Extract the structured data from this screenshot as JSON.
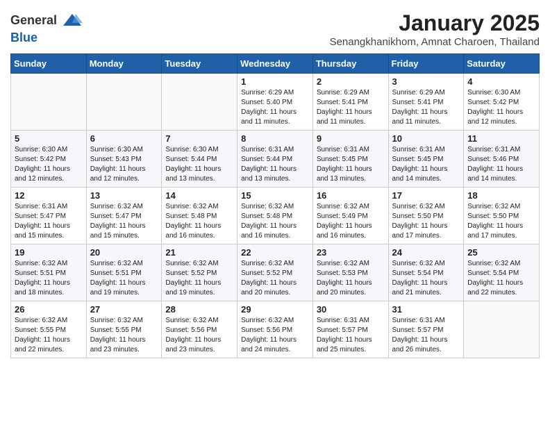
{
  "logo": {
    "general": "General",
    "blue": "Blue"
  },
  "title": "January 2025",
  "subtitle": "Senangkhanikhom, Amnat Charoen, Thailand",
  "headers": [
    "Sunday",
    "Monday",
    "Tuesday",
    "Wednesday",
    "Thursday",
    "Friday",
    "Saturday"
  ],
  "weeks": [
    [
      {
        "day": "",
        "info": ""
      },
      {
        "day": "",
        "info": ""
      },
      {
        "day": "",
        "info": ""
      },
      {
        "day": "1",
        "info": "Sunrise: 6:29 AM\nSunset: 5:40 PM\nDaylight: 11 hours\nand 11 minutes."
      },
      {
        "day": "2",
        "info": "Sunrise: 6:29 AM\nSunset: 5:41 PM\nDaylight: 11 hours\nand 11 minutes."
      },
      {
        "day": "3",
        "info": "Sunrise: 6:29 AM\nSunset: 5:41 PM\nDaylight: 11 hours\nand 11 minutes."
      },
      {
        "day": "4",
        "info": "Sunrise: 6:30 AM\nSunset: 5:42 PM\nDaylight: 11 hours\nand 12 minutes."
      }
    ],
    [
      {
        "day": "5",
        "info": "Sunrise: 6:30 AM\nSunset: 5:42 PM\nDaylight: 11 hours\nand 12 minutes."
      },
      {
        "day": "6",
        "info": "Sunrise: 6:30 AM\nSunset: 5:43 PM\nDaylight: 11 hours\nand 12 minutes."
      },
      {
        "day": "7",
        "info": "Sunrise: 6:30 AM\nSunset: 5:44 PM\nDaylight: 11 hours\nand 13 minutes."
      },
      {
        "day": "8",
        "info": "Sunrise: 6:31 AM\nSunset: 5:44 PM\nDaylight: 11 hours\nand 13 minutes."
      },
      {
        "day": "9",
        "info": "Sunrise: 6:31 AM\nSunset: 5:45 PM\nDaylight: 11 hours\nand 13 minutes."
      },
      {
        "day": "10",
        "info": "Sunrise: 6:31 AM\nSunset: 5:45 PM\nDaylight: 11 hours\nand 14 minutes."
      },
      {
        "day": "11",
        "info": "Sunrise: 6:31 AM\nSunset: 5:46 PM\nDaylight: 11 hours\nand 14 minutes."
      }
    ],
    [
      {
        "day": "12",
        "info": "Sunrise: 6:31 AM\nSunset: 5:47 PM\nDaylight: 11 hours\nand 15 minutes."
      },
      {
        "day": "13",
        "info": "Sunrise: 6:32 AM\nSunset: 5:47 PM\nDaylight: 11 hours\nand 15 minutes."
      },
      {
        "day": "14",
        "info": "Sunrise: 6:32 AM\nSunset: 5:48 PM\nDaylight: 11 hours\nand 16 minutes."
      },
      {
        "day": "15",
        "info": "Sunrise: 6:32 AM\nSunset: 5:48 PM\nDaylight: 11 hours\nand 16 minutes."
      },
      {
        "day": "16",
        "info": "Sunrise: 6:32 AM\nSunset: 5:49 PM\nDaylight: 11 hours\nand 16 minutes."
      },
      {
        "day": "17",
        "info": "Sunrise: 6:32 AM\nSunset: 5:50 PM\nDaylight: 11 hours\nand 17 minutes."
      },
      {
        "day": "18",
        "info": "Sunrise: 6:32 AM\nSunset: 5:50 PM\nDaylight: 11 hours\nand 17 minutes."
      }
    ],
    [
      {
        "day": "19",
        "info": "Sunrise: 6:32 AM\nSunset: 5:51 PM\nDaylight: 11 hours\nand 18 minutes."
      },
      {
        "day": "20",
        "info": "Sunrise: 6:32 AM\nSunset: 5:51 PM\nDaylight: 11 hours\nand 19 minutes."
      },
      {
        "day": "21",
        "info": "Sunrise: 6:32 AM\nSunset: 5:52 PM\nDaylight: 11 hours\nand 19 minutes."
      },
      {
        "day": "22",
        "info": "Sunrise: 6:32 AM\nSunset: 5:52 PM\nDaylight: 11 hours\nand 20 minutes."
      },
      {
        "day": "23",
        "info": "Sunrise: 6:32 AM\nSunset: 5:53 PM\nDaylight: 11 hours\nand 20 minutes."
      },
      {
        "day": "24",
        "info": "Sunrise: 6:32 AM\nSunset: 5:54 PM\nDaylight: 11 hours\nand 21 minutes."
      },
      {
        "day": "25",
        "info": "Sunrise: 6:32 AM\nSunset: 5:54 PM\nDaylight: 11 hours\nand 22 minutes."
      }
    ],
    [
      {
        "day": "26",
        "info": "Sunrise: 6:32 AM\nSunset: 5:55 PM\nDaylight: 11 hours\nand 22 minutes."
      },
      {
        "day": "27",
        "info": "Sunrise: 6:32 AM\nSunset: 5:55 PM\nDaylight: 11 hours\nand 23 minutes."
      },
      {
        "day": "28",
        "info": "Sunrise: 6:32 AM\nSunset: 5:56 PM\nDaylight: 11 hours\nand 23 minutes."
      },
      {
        "day": "29",
        "info": "Sunrise: 6:32 AM\nSunset: 5:56 PM\nDaylight: 11 hours\nand 24 minutes."
      },
      {
        "day": "30",
        "info": "Sunrise: 6:31 AM\nSunset: 5:57 PM\nDaylight: 11 hours\nand 25 minutes."
      },
      {
        "day": "31",
        "info": "Sunrise: 6:31 AM\nSunset: 5:57 PM\nDaylight: 11 hours\nand 26 minutes."
      },
      {
        "day": "",
        "info": ""
      }
    ]
  ]
}
